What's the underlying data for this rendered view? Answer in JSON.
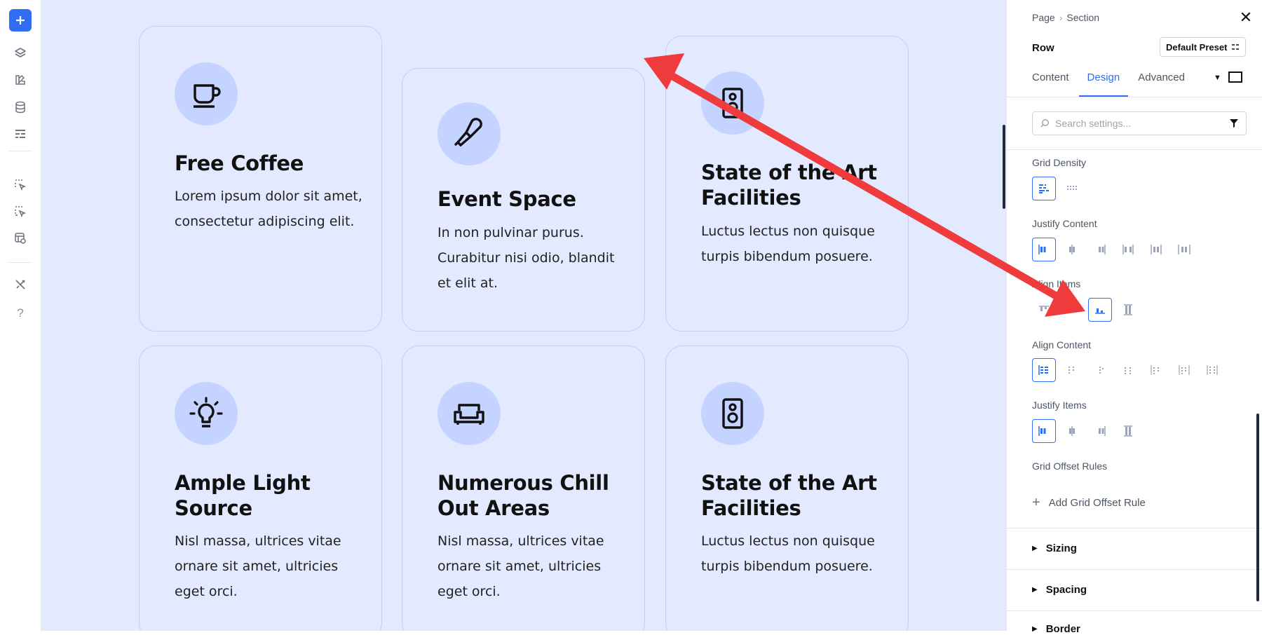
{
  "toolbar": {
    "items": [
      {
        "name": "add-button",
        "icon": "plus-icon"
      },
      {
        "name": "layers-button",
        "icon": "layers-icon"
      },
      {
        "name": "design-library-button",
        "icon": "palette-icon"
      },
      {
        "name": "database-button",
        "icon": "database-icon"
      },
      {
        "name": "layout-button",
        "icon": "layout-icon"
      },
      {
        "name": "select-button",
        "icon": "cursor-select-icon"
      },
      {
        "name": "multi-select-button",
        "icon": "multi-select-icon"
      },
      {
        "name": "preview-button",
        "icon": "preview-icon"
      },
      {
        "name": "tools-button",
        "icon": "tools-icon"
      }
    ],
    "help_label": "?"
  },
  "canvas": {
    "background": "#e3eaff",
    "cards": [
      {
        "icon": "coffee-cup-icon",
        "title": "Free Coffee",
        "body": "Lorem ipsum dolor sit amet, consectetur adipiscing elit."
      },
      {
        "icon": "microphone-icon",
        "title": "Event Space",
        "body": "In non pulvinar purus. Curabitur nisi odio, blandit et elit at."
      },
      {
        "icon": "speaker-icon",
        "title": "State of the Art Facilities",
        "body": "Luctus lectus non quisque turpis bibendum posuere."
      },
      {
        "icon": "lightbulb-icon",
        "title": "Ample Light Source",
        "body": "Nisl massa, ultrices vitae ornare sit amet, ultricies eget orci."
      },
      {
        "icon": "sofa-icon",
        "title": "Numerous Chill Out Areas",
        "body": "Nisl massa, ultrices vitae ornare sit amet, ultricies eget orci."
      },
      {
        "icon": "speaker-icon",
        "title": "State of the Art Facilities",
        "body": "Luctus lectus non quisque turpis bibendum posuere."
      }
    ]
  },
  "panel": {
    "breadcrumb": {
      "page": "Page",
      "separator": "›",
      "section": "Section"
    },
    "close_label": "✕",
    "element_label": "Row",
    "preset_label": "Default Preset",
    "tabs": [
      {
        "label": "Content",
        "active": false
      },
      {
        "label": "Design",
        "active": true
      },
      {
        "label": "Advanced",
        "active": false
      }
    ],
    "search": {
      "placeholder": "Search settings...",
      "value": ""
    },
    "groups": {
      "grid_density": {
        "label": "Grid Density",
        "options": 2,
        "selected": 0
      },
      "justify_content": {
        "label": "Justify Content",
        "options": 6,
        "selected": 0
      },
      "align_items": {
        "label": "Align Items",
        "options": 4,
        "selected": 2
      },
      "align_content": {
        "label": "Align Content",
        "options": 7,
        "selected": 0
      },
      "justify_items": {
        "label": "Justify Items",
        "options": 4,
        "selected": 0
      },
      "grid_offset_rules": {
        "label": "Grid Offset Rules"
      }
    },
    "add_offset_label": "Add Grid Offset Rule",
    "sections": [
      "Sizing",
      "Spacing",
      "Border"
    ]
  },
  "colors": {
    "accent": "#2f6ef3",
    "arrow": "#ef3b3b",
    "icon_bg": "#c4d3ff"
  }
}
